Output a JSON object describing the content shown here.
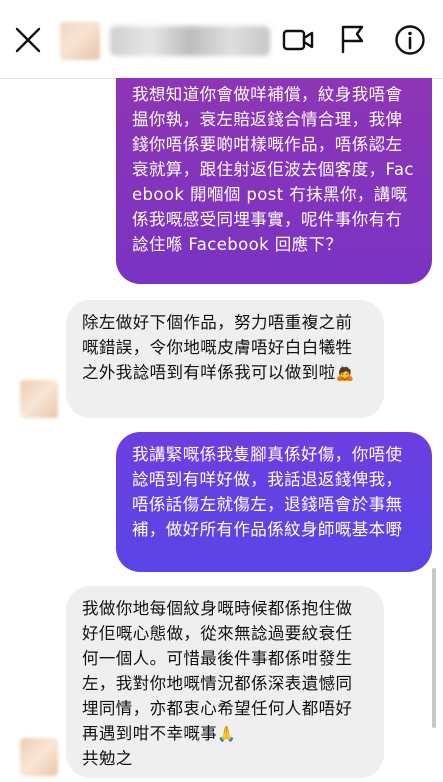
{
  "header": {
    "icons": [
      "close-icon",
      "video-call-icon",
      "flag-icon",
      "info-icon"
    ]
  },
  "messages": [
    {
      "direction": "sent",
      "text": "我想知道你會做咩補償，紋身我唔會揾你執，衰左賠返錢合情合理，我俾錢你唔係要啲咁樣嘅作品，唔係認左衰就算，跟住射返佢波去個客度，Facebook 開嗰個 post 冇抹黑你，講嘅係我嘅感受同埋事實，呢件事你有冇諗住喺 Facebook 回應下？"
    },
    {
      "direction": "received",
      "text": "除左做好下個作品，努力唔重複之前嘅錯誤，令你地嘅皮膚唔好白白犧牲之外我諗唔到有咩係我可以做到啦",
      "emoji": "🙇"
    },
    {
      "direction": "sent",
      "text": "我講緊嘅係我隻腳真係好傷，你唔使諗唔到有咩好做，我話退返錢俾我，唔係話傷左就傷左，退錢唔會於事無補，做好所有作品係紋身師嘅基本嘢"
    },
    {
      "direction": "received",
      "text": "我做你地每個紋身嘅時候都係抱住做好佢嘅心態做，從來無諗過要紋衰任何一個人。可惜最後件事都係咁發生左，我對你地嘅情況都係深表遺憾同埋同情，亦都衷心希望任何人都唔好再遇到咁不幸嘅事",
      "emoji": "🙏",
      "tail": "共勉之"
    }
  ],
  "colors": {
    "sent_bubble_1": "#8e35b5",
    "sent_bubble_2": "#6d3ee0",
    "received_bubble": "#efefef"
  }
}
